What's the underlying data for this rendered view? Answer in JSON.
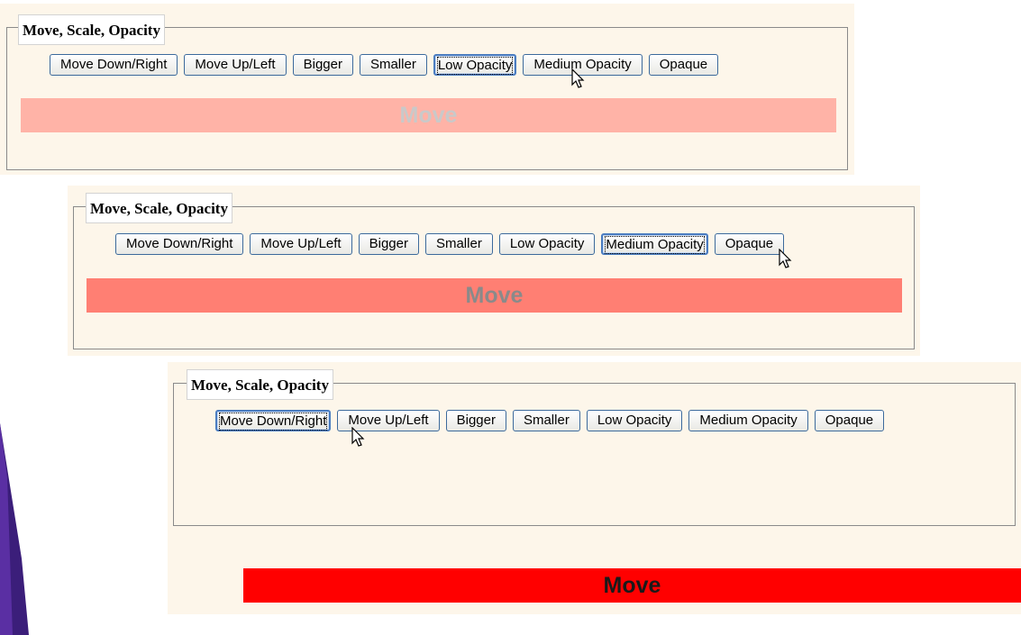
{
  "colors": {
    "page_background": "#fdf6ea",
    "button_border": "#3c6a9c",
    "move_low_opacity": "#ffb3a7",
    "move_medium_opacity": "#ff7f73",
    "move_opaque": "#ff0000",
    "accent": "#3b1e7a"
  },
  "icons": {
    "cursor": "mouse-pointer-icon"
  },
  "panels": [
    {
      "legend": "Move, Scale, Opacity",
      "buttons": [
        "Move Down/Right",
        "Move Up/Left",
        "Bigger",
        "Smaller",
        "Low Opacity",
        "Medium Opacity",
        "Opaque"
      ],
      "focused_button": "Low Opacity",
      "box_label": "Move",
      "box_state": "low opacity"
    },
    {
      "legend": "Move, Scale, Opacity",
      "buttons": [
        "Move Down/Right",
        "Move Up/Left",
        "Bigger",
        "Smaller",
        "Low Opacity",
        "Medium Opacity",
        "Opaque"
      ],
      "focused_button": "Medium Opacity",
      "box_label": "Move",
      "box_state": "medium opacity"
    },
    {
      "legend": "Move, Scale, Opacity",
      "buttons": [
        "Move Down/Right",
        "Move Up/Left",
        "Bigger",
        "Smaller",
        "Low Opacity",
        "Medium Opacity",
        "Opaque"
      ],
      "focused_button": "Move Down/Right",
      "box_label": "Move",
      "box_state": "opaque, moved down/right"
    }
  ]
}
